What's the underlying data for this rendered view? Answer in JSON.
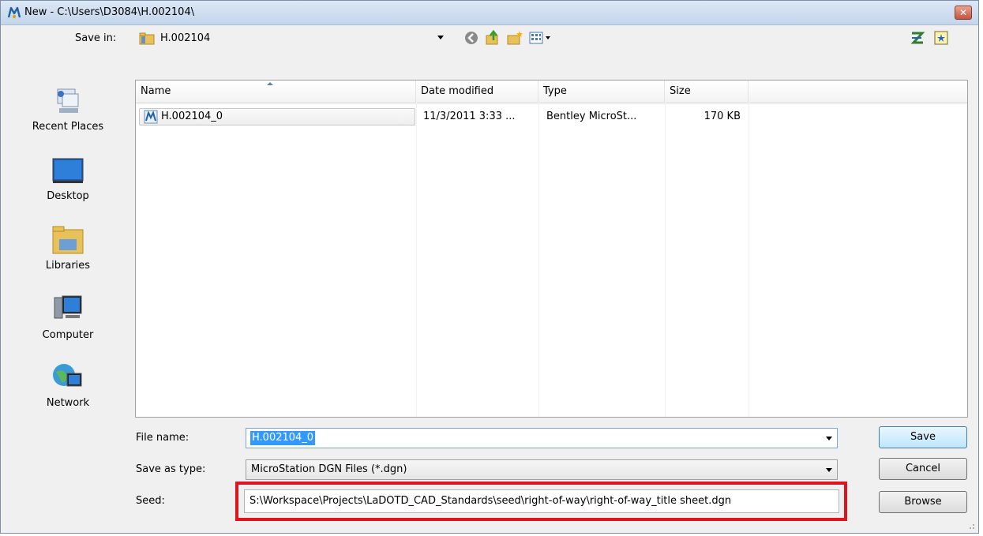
{
  "window": {
    "title": "New - C:\\Users\\D3084\\H.002104\\",
    "close_symbol": "✕"
  },
  "toolbar": {
    "save_in_label": "Save in:",
    "save_in_value": "H.002104",
    "icons": [
      "back-icon",
      "up-folder-icon",
      "new-folder-icon",
      "view-menu-icon",
      "microstation-settings-icon",
      "directory-icon"
    ]
  },
  "places": [
    {
      "label": "Recent Places",
      "icon": "recent-places-icon"
    },
    {
      "label": "Desktop",
      "icon": "desktop-icon"
    },
    {
      "label": "Libraries",
      "icon": "libraries-icon"
    },
    {
      "label": "Computer",
      "icon": "computer-icon"
    },
    {
      "label": "Network",
      "icon": "network-icon"
    }
  ],
  "file_list": {
    "columns": [
      "Name",
      "Date modified",
      "Type",
      "Size"
    ],
    "rows": [
      {
        "name": "H.002104_0",
        "date": "11/3/2011 3:33 ...",
        "type": "Bentley MicroSt...",
        "size": "170 KB"
      }
    ]
  },
  "form": {
    "file_name_label": "File name:",
    "file_name_value": "H.002104_0",
    "save_type_label": "Save as type:",
    "save_type_value": "MicroStation DGN Files (*.dgn)",
    "seed_label": "Seed:",
    "seed_value": "S:\\Workspace\\Projects\\LaDOTD_CAD_Standards\\seed\\right-of-way\\right-of-way_title sheet.dgn"
  },
  "buttons": {
    "save": "Save",
    "cancel": "Cancel",
    "browse": "Browse"
  },
  "colors": {
    "highlight": "#e0141e",
    "selection": "#3399ff"
  }
}
